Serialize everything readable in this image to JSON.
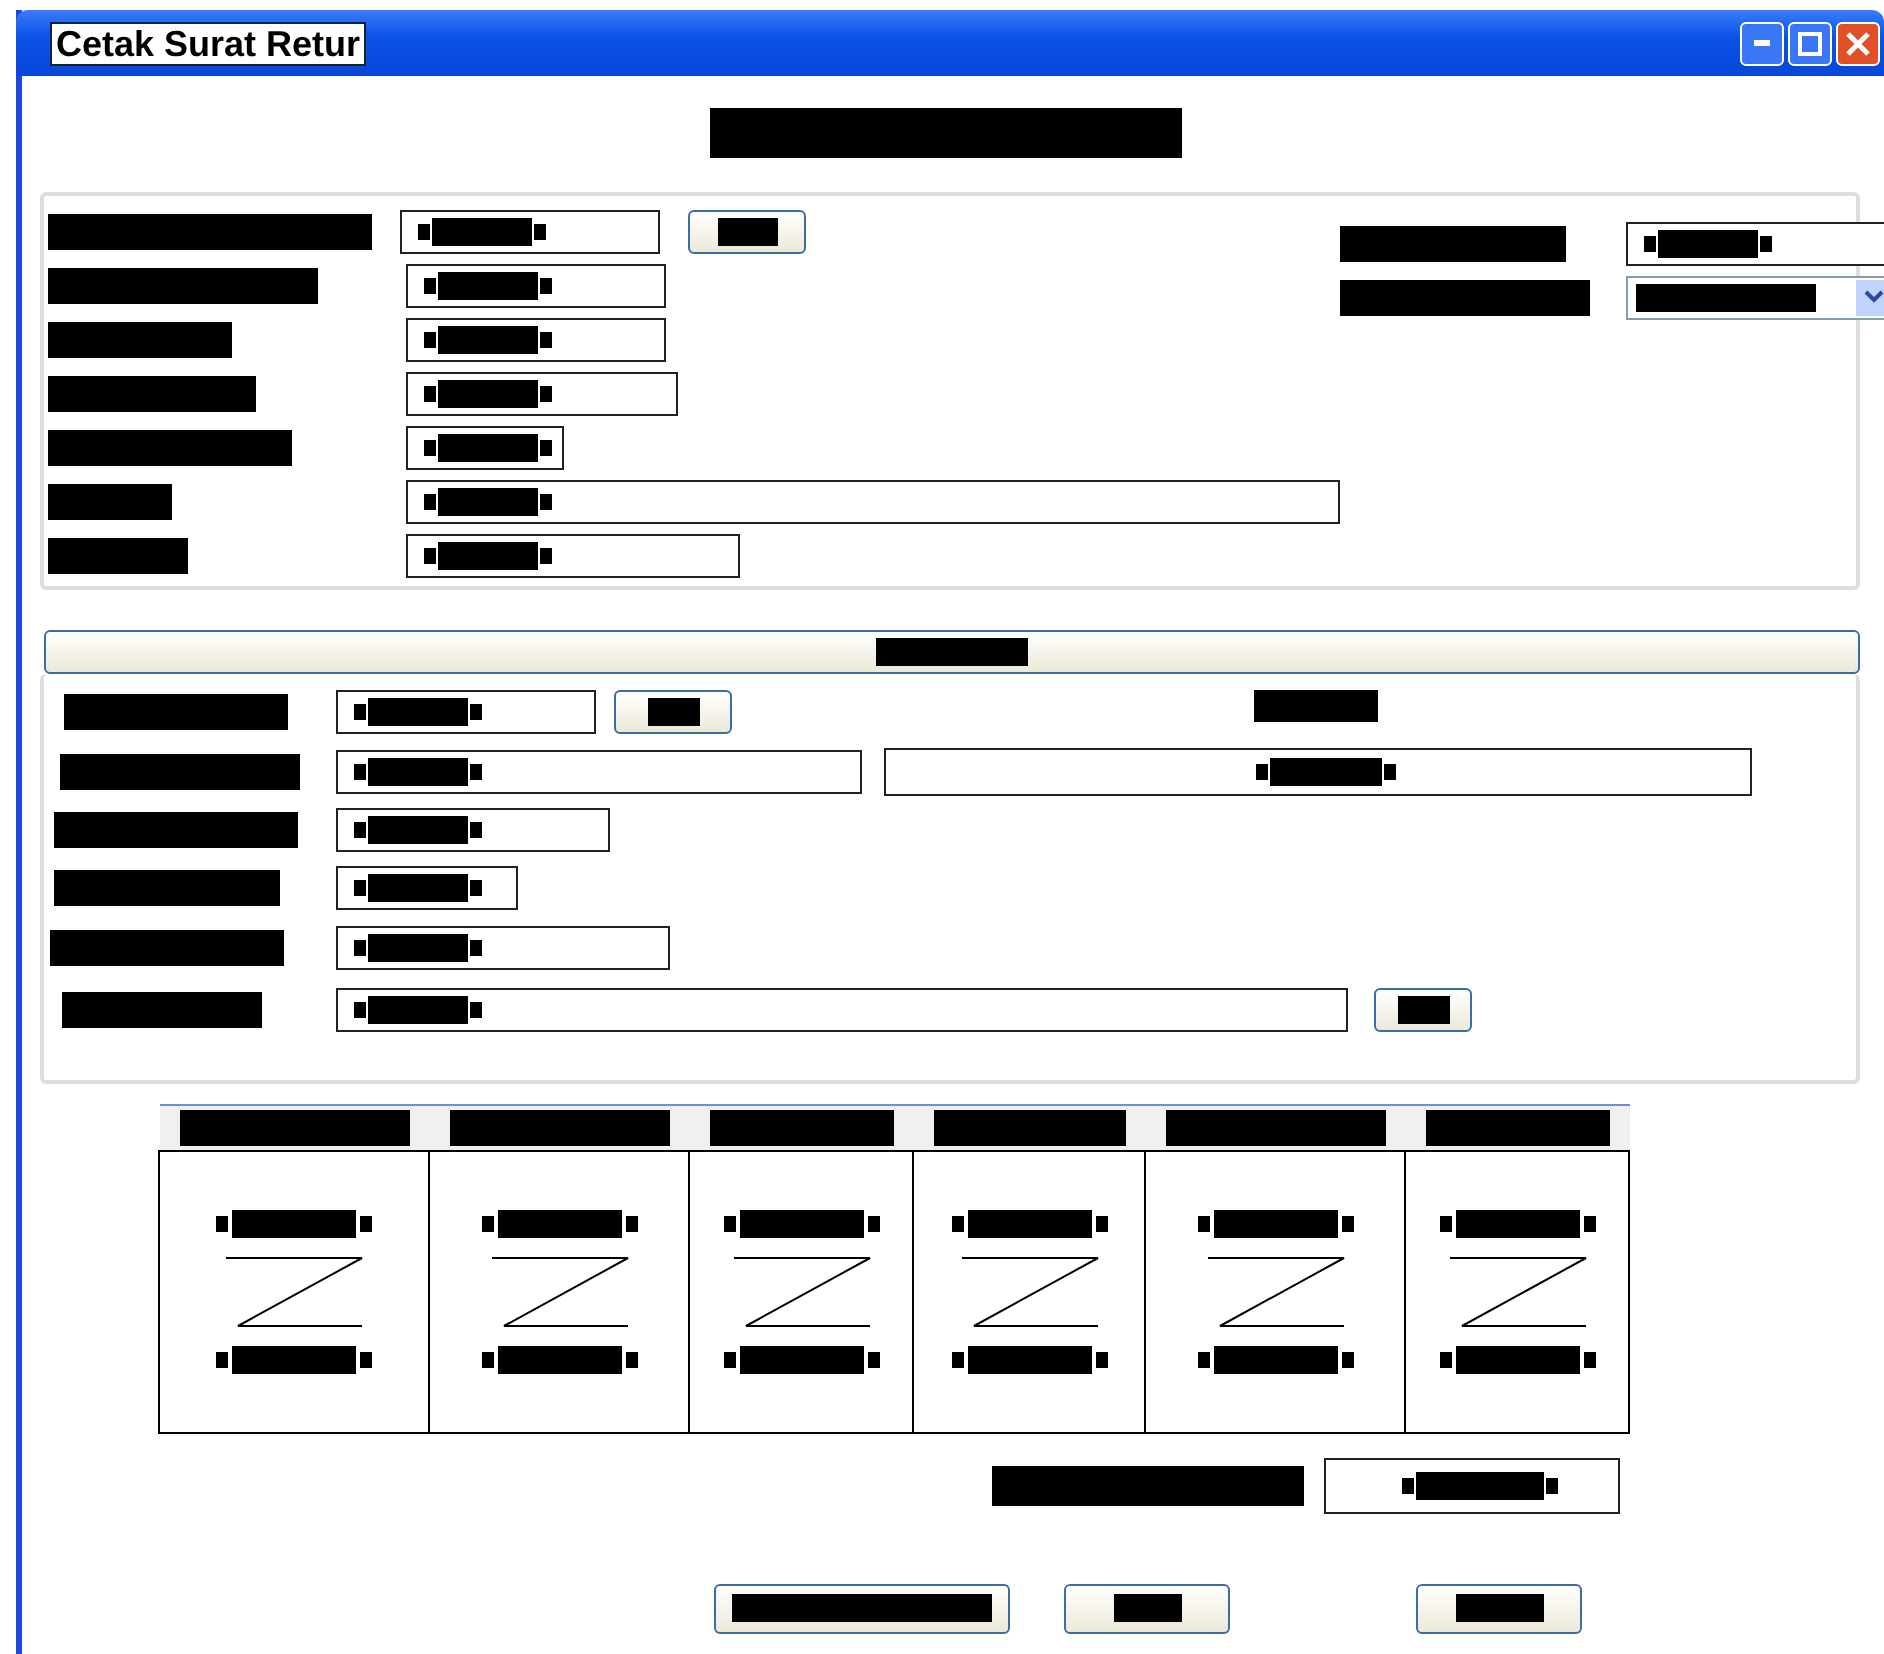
{
  "window": {
    "title": "Cetak Surat Retur"
  },
  "heading": {
    "kind": "redacted"
  },
  "top_panel": {
    "left_rows": [
      {
        "kind": "input_button"
      },
      {
        "kind": "input"
      },
      {
        "kind": "input"
      },
      {
        "kind": "input"
      },
      {
        "kind": "input"
      },
      {
        "kind": "input"
      },
      {
        "kind": "input"
      }
    ],
    "right_rows": [
      {
        "kind": "input"
      },
      {
        "kind": "select"
      }
    ]
  },
  "detail_panel": {
    "header": {
      "kind": "redacted"
    },
    "rows": [
      {
        "kind": "input_button"
      },
      {
        "kind": "input_box"
      },
      {
        "kind": "input"
      },
      {
        "kind": "input"
      },
      {
        "kind": "input"
      },
      {
        "kind": "input_button"
      }
    ]
  },
  "table": {
    "columns": [
      {
        "kind": "redacted"
      },
      {
        "kind": "redacted"
      },
      {
        "kind": "redacted"
      },
      {
        "kind": "redacted"
      },
      {
        "kind": "redacted"
      },
      {
        "kind": "redacted"
      }
    ],
    "rows": [
      {
        "cells": [
          {
            "kind": "range"
          },
          {
            "kind": "range"
          },
          {
            "kind": "range"
          },
          {
            "kind": "range"
          },
          {
            "kind": "range"
          },
          {
            "kind": "range"
          }
        ]
      }
    ]
  },
  "total": {
    "kind": "input"
  },
  "buttons": [
    {
      "kind": "redacted"
    },
    {
      "kind": "redacted"
    },
    {
      "kind": "redacted"
    }
  ]
}
